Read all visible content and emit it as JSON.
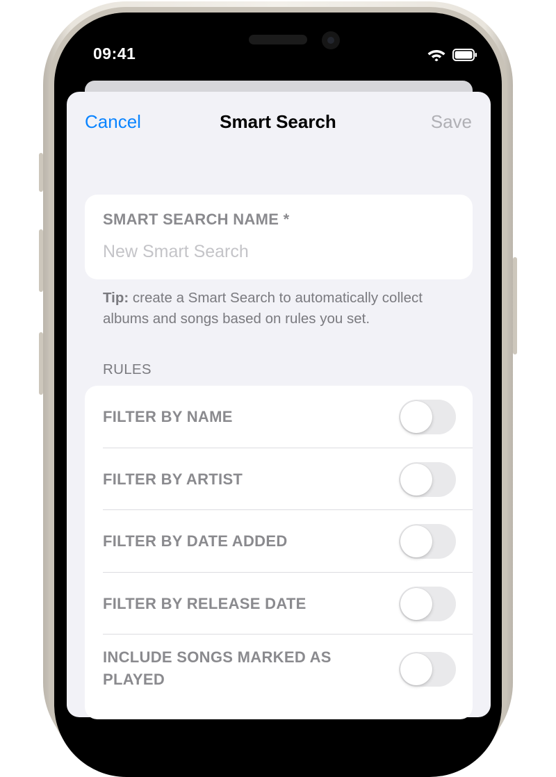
{
  "status_bar": {
    "time": "09:41",
    "wifi_icon": "wifi-icon",
    "battery_icon": "battery-icon"
  },
  "nav": {
    "cancel": "Cancel",
    "title": "Smart Search",
    "save": "Save"
  },
  "name_field": {
    "label": "SMART SEARCH NAME *",
    "placeholder": "New Smart Search",
    "value": ""
  },
  "tip": {
    "bold": "Tip:",
    "text": " create a Smart Search to automatically collect albums and songs based on rules you set."
  },
  "rules": {
    "header": "RULES",
    "items": [
      {
        "label": "FILTER BY NAME",
        "enabled": false
      },
      {
        "label": "FILTER BY ARTIST",
        "enabled": false
      },
      {
        "label": "FILTER BY DATE ADDED",
        "enabled": false
      },
      {
        "label": "FILTER BY RELEASE DATE",
        "enabled": false
      },
      {
        "label": "INCLUDE SONGS MARKED AS PLAYED",
        "enabled": false
      }
    ]
  },
  "colors": {
    "accent": "#0a84ff",
    "background": "#f2f2f7",
    "toggle_off": "#e9e9eb"
  }
}
